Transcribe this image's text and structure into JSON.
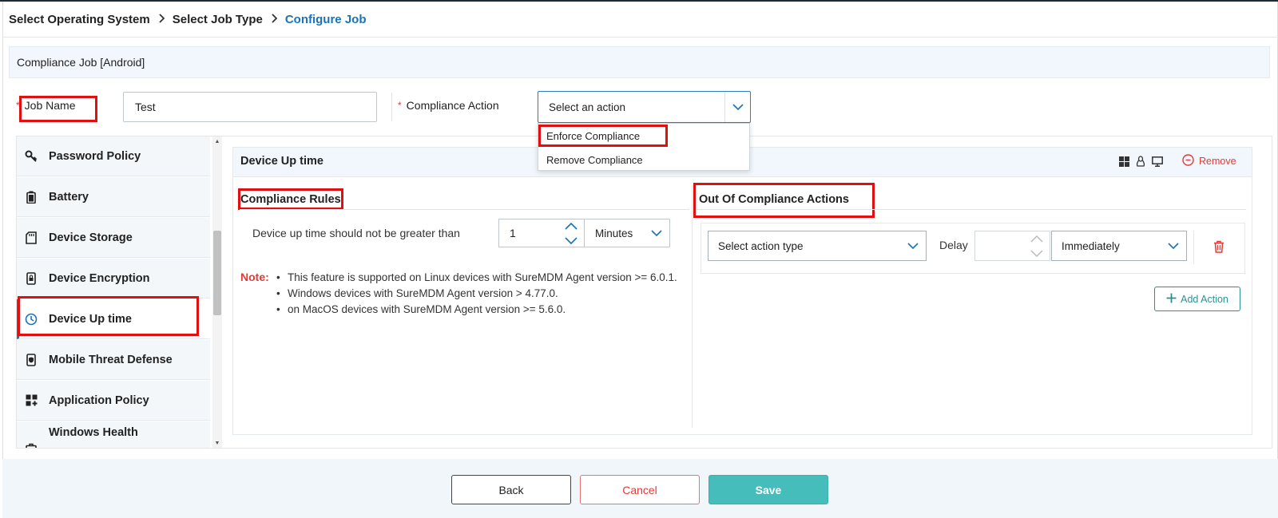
{
  "breadcrumb": {
    "step1": "Select Operating System",
    "step2": "Select Job Type",
    "step3": "Configure Job",
    "separator": ">"
  },
  "header": {
    "title": "Compliance Job [Android]"
  },
  "form": {
    "job_name_label": "Job Name",
    "job_name_value": "Test",
    "compliance_action_label": "Compliance Action",
    "compliance_action_placeholder": "Select an action",
    "required_mark": "*",
    "dropdown_options": [
      "Enforce Compliance",
      "Remove Compliance"
    ]
  },
  "sidebar": {
    "items": [
      {
        "label": "Password Policy",
        "icon": "key-icon"
      },
      {
        "label": "Battery",
        "icon": "battery-icon"
      },
      {
        "label": "Device Storage",
        "icon": "sd-card-icon"
      },
      {
        "label": "Device Encryption",
        "icon": "phone-lock-icon"
      },
      {
        "label": "Device Up time",
        "icon": "clock-icon",
        "active": true
      },
      {
        "label": "Mobile Threat Defense",
        "icon": "phone-shield-icon"
      },
      {
        "label": "Application Policy",
        "icon": "apps-grid-icon"
      },
      {
        "label": "Windows Health",
        "icon": "medical-kit-icon"
      }
    ]
  },
  "panel": {
    "title": "Device Up time",
    "remove_label": "Remove",
    "rules_title": "Compliance Rules",
    "actions_title": "Out Of Compliance Actions",
    "rule_text": "Device up time should not be greater than",
    "rule_value": "1",
    "rule_unit": "Minutes",
    "note_label": "Note:",
    "notes": [
      "This feature is supported on Linux devices with SureMDM Agent version >= 6.0.1.",
      "Windows devices with SureMDM Agent version > 4.77.0.",
      "on MacOS devices with SureMDM Agent version >= 5.6.0."
    ],
    "action_type_placeholder": "Select action type",
    "delay_label": "Delay",
    "delay_value": "",
    "delay_unit": "Immediately",
    "add_action_label": "Add Action"
  },
  "footer": {
    "back": "Back",
    "cancel": "Cancel",
    "save": "Save"
  },
  "colors": {
    "accent": "#1a73b8",
    "save": "#45bdbb",
    "danger": "#e53935",
    "highlight": "#e01010"
  }
}
